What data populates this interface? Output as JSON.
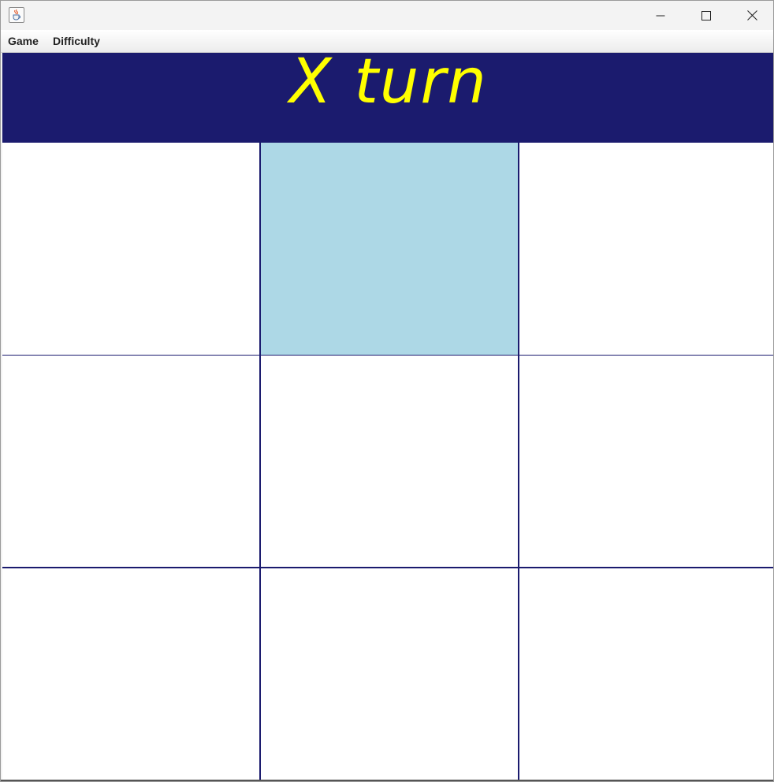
{
  "window": {
    "icon": "java-cup-icon",
    "controls": {
      "minimize_icon": "minimize-icon",
      "maximize_icon": "maximize-icon",
      "close_icon": "close-icon"
    }
  },
  "menubar": {
    "items": [
      {
        "label": "Game"
      },
      {
        "label": "Difficulty"
      }
    ]
  },
  "status": {
    "text": "X turn",
    "text_color": "#ffff00",
    "background_color": "#1b1b6e"
  },
  "board": {
    "rows": 3,
    "cols": 3,
    "grid_color": "#1b1b6e",
    "hover_color": "#add8e6",
    "hovered_cell": "0,1",
    "cells": [
      [
        "",
        "",
        ""
      ],
      [
        "",
        "",
        ""
      ],
      [
        "",
        "",
        ""
      ]
    ]
  }
}
